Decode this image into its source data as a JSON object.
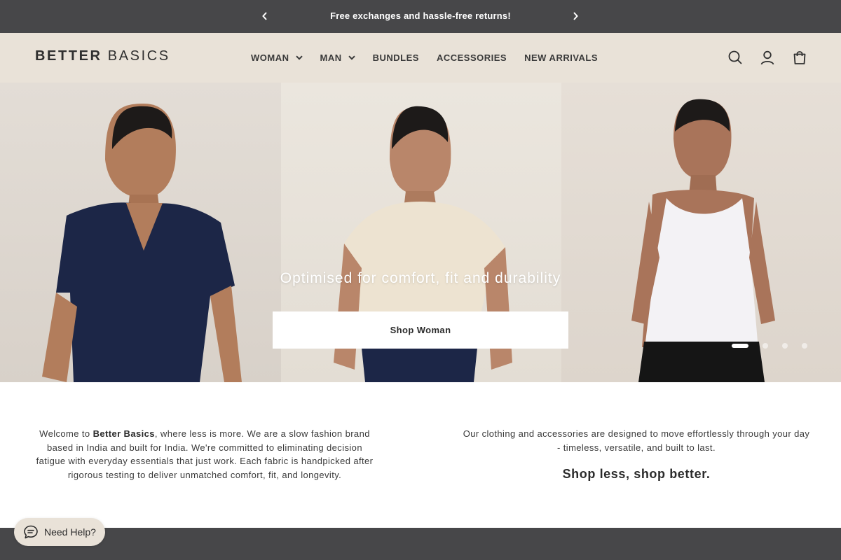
{
  "announcement": {
    "message": "Free exchanges and hassle-free returns!",
    "prev_icon": "chevron-left-icon",
    "next_icon": "chevron-right-icon"
  },
  "header": {
    "logo_part1": "BETTER",
    "logo_part2": "BASICS",
    "nav": [
      {
        "label": "WOMAN",
        "has_dropdown": true
      },
      {
        "label": "MAN",
        "has_dropdown": true
      },
      {
        "label": "BUNDLES",
        "has_dropdown": false
      },
      {
        "label": "ACCESSORIES",
        "has_dropdown": false
      },
      {
        "label": "NEW ARRIVALS",
        "has_dropdown": false
      }
    ],
    "icons": [
      "search-icon",
      "account-icon",
      "cart-icon"
    ]
  },
  "hero": {
    "title": "Optimised for comfort, fit and durability",
    "cta_label": "Shop Woman",
    "slides_total": 4,
    "active_slide": 1
  },
  "intro": {
    "left_prefix": "Welcome to ",
    "left_brand": "Better Basics",
    "left_rest": ", where less is more. We are a slow fashion brand based in India and built for India. We're committed to eliminating decision fatigue with everyday essentials that just work. Each fabric is handpicked after rigorous testing to deliver unmatched comfort, fit, and longevity.",
    "right_text": "Our clothing and accessories are designed to move effortlessly through your day - timeless, versatile, and built to last.",
    "tagline": "Shop less, shop better."
  },
  "help": {
    "label": "Need Help?",
    "icon": "chat-bubble-icon"
  },
  "colors": {
    "announcement_bg": "#474749",
    "header_bg": "#e9e2d8",
    "text_dark": "#2b2b2b"
  }
}
